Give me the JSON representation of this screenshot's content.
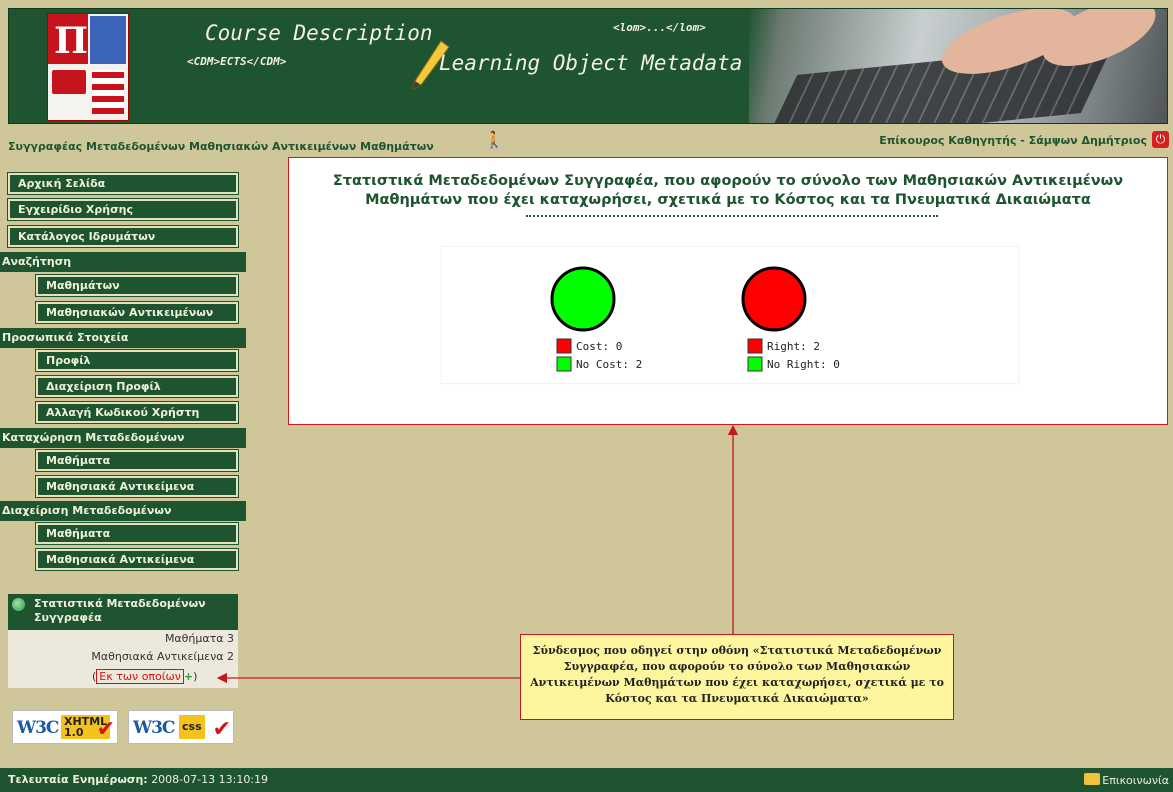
{
  "header": {
    "course_description": "Course Description",
    "cdm_tag": "<CDM>ECTS</CDM>",
    "lom_tag": "<lom>...</lom>",
    "lom_title": "Learning Object Metadata"
  },
  "author_bar": {
    "role_title": "Συγγραφέας Μεταδεδομένων Μαθησιακών Αντικειμένων Μαθημάτων",
    "user": "Επίκουρος Καθηγητής - Σάμψων Δημήτριος"
  },
  "sidebar": {
    "home": "Αρχική Σελίδα",
    "manual": "Εγχειρίδιο Χρήσης",
    "institutions": "Κατάλογος Ιδρυμάτων",
    "search_section": "Αναζήτηση",
    "search_courses": "Μαθημάτων",
    "search_learning_objects": "Μαθησιακών Αντικειμένων",
    "personal_section": "Προσωπικά Στοιχεία",
    "profile": "Προφίλ",
    "profile_management": "Διαχείριση Προφίλ",
    "change_password": "Αλλαγή Κωδικού Χρήστη",
    "register_section": "Καταχώρηση Μεταδεδομένων",
    "register_courses": "Μαθήματα",
    "register_learning_objects": "Μαθησιακά Αντικείμενα",
    "manage_section": "Διαχείριση Μεταδεδομένων",
    "manage_courses": "Μαθήματα",
    "manage_learning_objects": "Μαθησιακά Αντικείμενα"
  },
  "stats_box": {
    "title": "Στατιστικά Μεταδεδομένων Συγγραφέα",
    "courses": "Μαθήματα 3",
    "learning_objects": "Μαθησιακά Αντικείμενα 2",
    "link_open": "(",
    "link_text": "Εκ των οποίων",
    "link_close": ")"
  },
  "badges": {
    "xhtml_w3c": "W3C",
    "xhtml_label_1": "XHTML",
    "xhtml_label_2": "1.0",
    "css_w3c": "W3C",
    "css_label": "css"
  },
  "main": {
    "title": "Στατιστικά Μεταδεδομένων Συγγραφέα, που αφορούν το σύνολο των Μαθησιακών Αντικειμένων Μαθημάτων που έχει καταχωρήσει, σχετικά με το Κόστος και τα Πνευματικά Δικαιώματα"
  },
  "chart_data": [
    {
      "type": "pie",
      "categories": [
        "Cost: 0",
        "No Cost: 2"
      ],
      "values": [
        0,
        2
      ],
      "colors": [
        "#ff0000",
        "#00ff00"
      ]
    },
    {
      "type": "pie",
      "categories": [
        "Right: 2",
        "No Right: 0"
      ],
      "values": [
        2,
        0
      ],
      "colors": [
        "#ff0000",
        "#00ff00"
      ]
    }
  ],
  "annotation": {
    "text": "Σύνδεσμος που οδηγεί στην οθόνη «Στατιστικά Μεταδεδομένων Συγγραφέα, που αφορούν το σύνολο των Μαθησιακών Αντικειμένων Μαθημάτων που έχει καταχωρήσει, σχετικά με το Κόστος και τα Πνευματικά Δικαιώματα»"
  },
  "footer": {
    "last_update_label": "Τελευταία Ενημέρωση:",
    "last_update_value": "2008-07-13 13:10:19",
    "contact": "Επικοινωνία"
  },
  "colors": {
    "green_dark": "#1e5530",
    "beige": "#cfc79a",
    "accent_red": "#d21818",
    "note_yellow": "#fdf69e"
  },
  "icons": [
    "university-logo",
    "pencil-icon",
    "keyboard-photo",
    "author-icon",
    "power-icon",
    "stats-icon",
    "plus-icon",
    "mail-icon",
    "w3c-xhtml-badge",
    "w3c-css-badge"
  ]
}
